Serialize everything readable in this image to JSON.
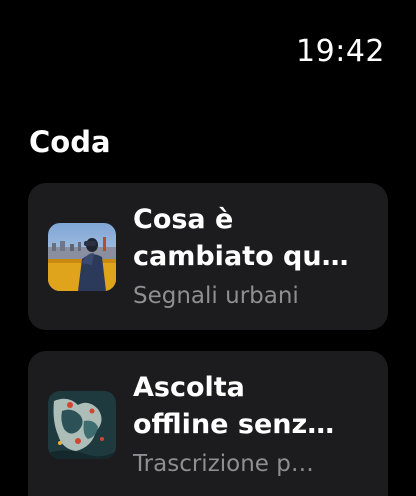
{
  "status": {
    "time": "19:42"
  },
  "section": {
    "title": "Coda"
  },
  "queue": [
    {
      "title": "Cosa è\ncambiato qu…",
      "subtitle": "Segnali urbani",
      "artwork_icon": "city-photographer-artwork"
    },
    {
      "title": "Ascolta\noffline senz…",
      "subtitle": "Trascrizione p…",
      "artwork_icon": "abstract-map-artwork"
    }
  ]
}
